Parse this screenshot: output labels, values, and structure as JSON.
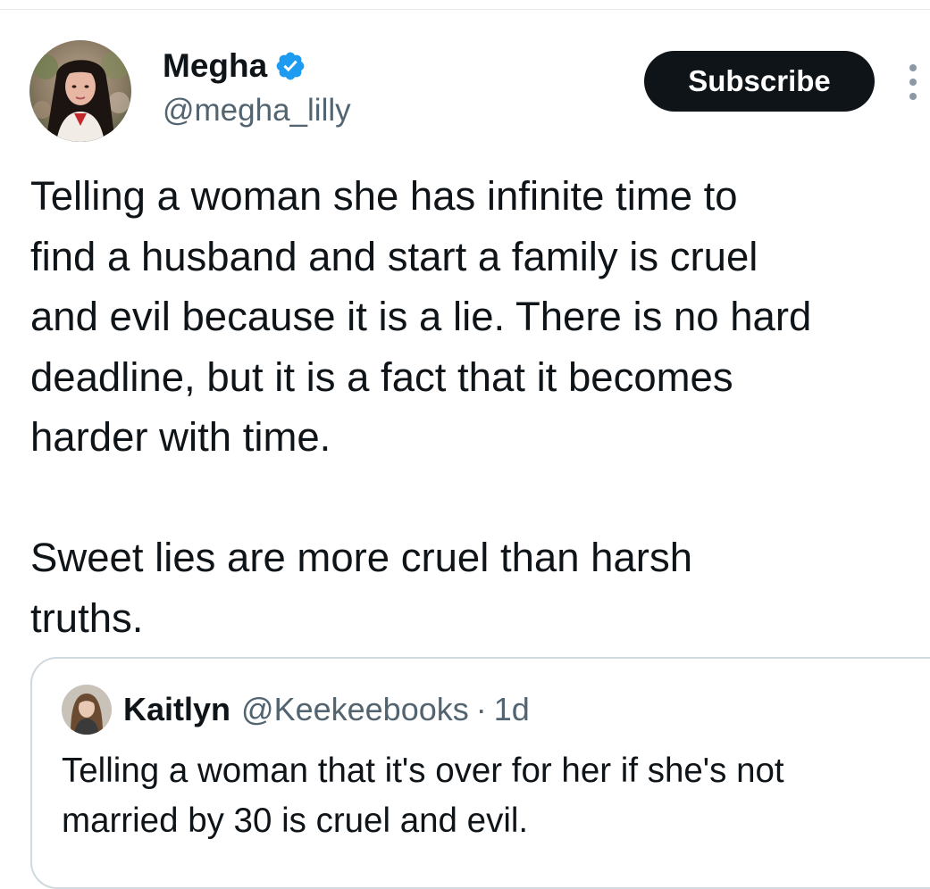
{
  "tweet": {
    "author": {
      "display_name": "Megha",
      "handle": "@megha_lilly",
      "verified_icon": "verified-badge-icon",
      "avatar_icon": "user-avatar"
    },
    "subscribe_label": "Subscribe",
    "more_icon": "more-vertical-icon",
    "text_lines_p1": [
      "Telling a woman she has infinite time to",
      "find a husband and start a family is cruel",
      "and evil because it is a lie. There is no hard",
      "deadline, but it is a fact that it becomes",
      "harder with time."
    ],
    "text_lines_p2": [
      "Sweet lies are more cruel than harsh",
      "truths."
    ]
  },
  "quoted": {
    "display_name": "Kaitlyn",
    "handle": "@Keekeebooks",
    "separator": "·",
    "time": "1d",
    "text_lines": [
      "Telling a woman that it's over for her if she's not",
      "married by 30 is cruel and evil."
    ]
  },
  "colors": {
    "text_primary": "#0f1419",
    "text_secondary": "#536471",
    "verified_blue": "#1d9bf0",
    "button_bg": "#0f1419",
    "border": "#cfd9de"
  }
}
